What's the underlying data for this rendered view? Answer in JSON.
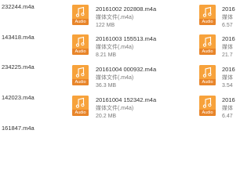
{
  "icon_label": "Audio",
  "columns": [
    {
      "items": [
        {
          "name": "232244.m4a"
        },
        {
          "name": "143418.m4a"
        },
        {
          "name": "234225.m4a"
        },
        {
          "name": "142023.m4a"
        },
        {
          "name": "161847.m4a"
        }
      ]
    },
    {
      "items": [
        {
          "name": "20161002 202808.m4a",
          "type": "媒体文件(.m4a)",
          "size": "122 MB"
        },
        {
          "name": "20161003 155513.m4a",
          "type": "媒体文件(.m4a)",
          "size": "8.21 MB"
        },
        {
          "name": "20161004 000932.m4a",
          "type": "媒体文件(.m4a)",
          "size": "36.3 MB"
        },
        {
          "name": "20161004 152342.m4a",
          "type": "媒体文件(.m4a)",
          "size": "20.2 MB"
        }
      ]
    },
    {
      "items": [
        {
          "name": "2016",
          "type": "媒体",
          "size": "6.57"
        },
        {
          "name": "2016",
          "type": "媒体",
          "size": "21.7"
        },
        {
          "name": "2016",
          "type": "媒体",
          "size": "3.54"
        },
        {
          "name": "2016",
          "type": "媒体",
          "size": "6.47"
        }
      ]
    }
  ]
}
